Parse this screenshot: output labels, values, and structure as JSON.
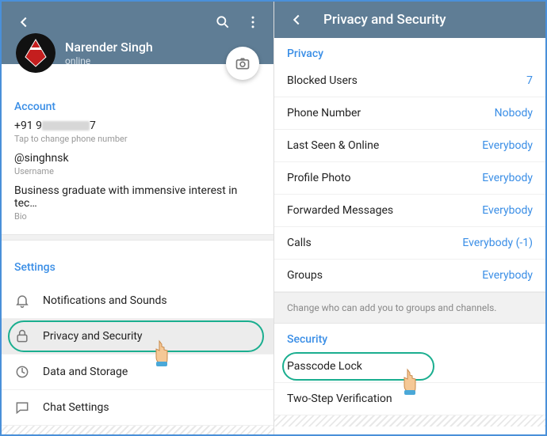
{
  "left": {
    "profile": {
      "name": "Narender Singh",
      "status": "online"
    },
    "account_header": "Account",
    "phone_prefix": "+91 9",
    "phone_suffix": "7",
    "phone_sub": "Tap to change phone number",
    "username": "@singhnsk",
    "username_sub": "Username",
    "bio": "Business graduate with immensive interest in tec…",
    "bio_sub": "Bio",
    "settings_header": "Settings",
    "settings_items": [
      {
        "label": "Notifications and Sounds"
      },
      {
        "label": "Privacy and Security"
      },
      {
        "label": "Data and Storage"
      },
      {
        "label": "Chat Settings"
      }
    ]
  },
  "right": {
    "title": "Privacy and Security",
    "privacy_header": "Privacy",
    "privacy_items": [
      {
        "label": "Blocked Users",
        "value": "7"
      },
      {
        "label": "Phone Number",
        "value": "Nobody"
      },
      {
        "label": "Last Seen & Online",
        "value": "Everybody"
      },
      {
        "label": "Profile Photo",
        "value": "Everybody"
      },
      {
        "label": "Forwarded Messages",
        "value": "Everybody"
      },
      {
        "label": "Calls",
        "value": "Everybody (-1)"
      },
      {
        "label": "Groups",
        "value": "Everybody"
      }
    ],
    "privacy_note": "Change who can add you to groups and channels.",
    "security_header": "Security",
    "security_items": [
      {
        "label": "Passcode Lock"
      },
      {
        "label": "Two-Step Verification"
      }
    ]
  }
}
